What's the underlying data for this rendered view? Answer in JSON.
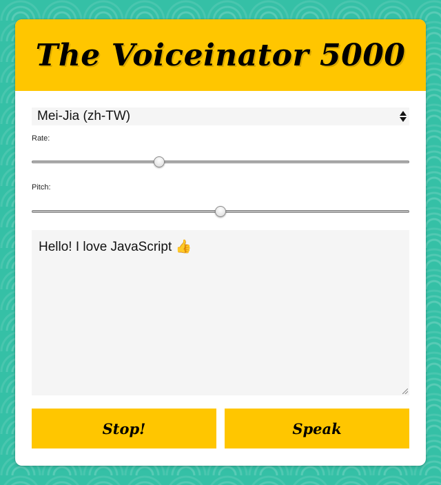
{
  "app": {
    "title": "The Voiceinator 5000"
  },
  "voice_select": {
    "selected": "Mei-Jia (zh-TW)"
  },
  "rate": {
    "label": "Rate:",
    "value": 1,
    "min": 0,
    "max": 3
  },
  "pitch": {
    "label": "Pitch:",
    "value": 1,
    "min": 0,
    "max": 2
  },
  "message": {
    "text": "Hello! I love JavaScript 👍"
  },
  "buttons": {
    "stop_label": "Stop!",
    "speak_label": "Speak"
  },
  "colors": {
    "background": "#35c0a6",
    "accent": "#ffc600",
    "field": "#f5f5f5"
  }
}
